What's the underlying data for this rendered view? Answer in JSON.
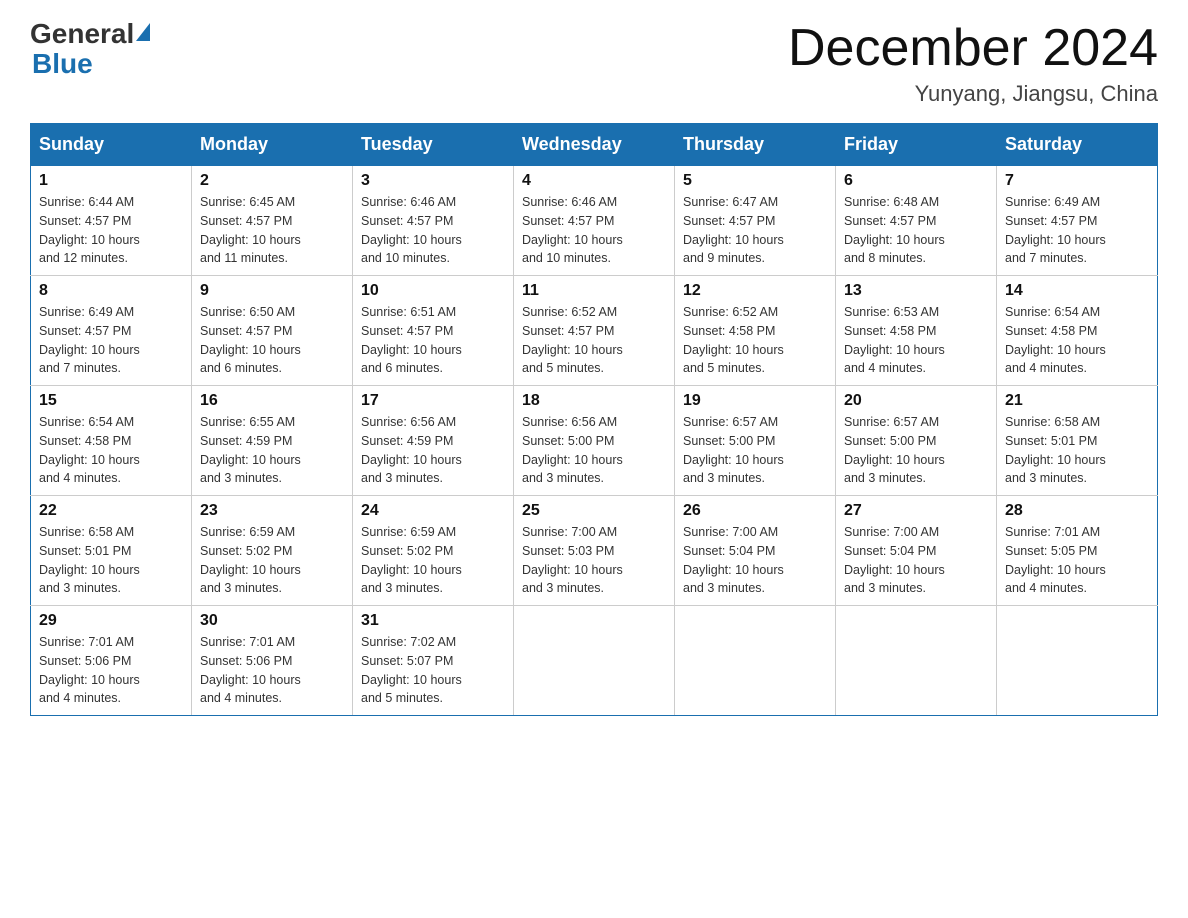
{
  "header": {
    "logo_general": "General",
    "logo_blue": "Blue",
    "title": "December 2024",
    "subtitle": "Yunyang, Jiangsu, China"
  },
  "columns": [
    "Sunday",
    "Monday",
    "Tuesday",
    "Wednesday",
    "Thursday",
    "Friday",
    "Saturday"
  ],
  "weeks": [
    [
      {
        "num": "1",
        "info": "Sunrise: 6:44 AM\nSunset: 4:57 PM\nDaylight: 10 hours\nand 12 minutes."
      },
      {
        "num": "2",
        "info": "Sunrise: 6:45 AM\nSunset: 4:57 PM\nDaylight: 10 hours\nand 11 minutes."
      },
      {
        "num": "3",
        "info": "Sunrise: 6:46 AM\nSunset: 4:57 PM\nDaylight: 10 hours\nand 10 minutes."
      },
      {
        "num": "4",
        "info": "Sunrise: 6:46 AM\nSunset: 4:57 PM\nDaylight: 10 hours\nand 10 minutes."
      },
      {
        "num": "5",
        "info": "Sunrise: 6:47 AM\nSunset: 4:57 PM\nDaylight: 10 hours\nand 9 minutes."
      },
      {
        "num": "6",
        "info": "Sunrise: 6:48 AM\nSunset: 4:57 PM\nDaylight: 10 hours\nand 8 minutes."
      },
      {
        "num": "7",
        "info": "Sunrise: 6:49 AM\nSunset: 4:57 PM\nDaylight: 10 hours\nand 7 minutes."
      }
    ],
    [
      {
        "num": "8",
        "info": "Sunrise: 6:49 AM\nSunset: 4:57 PM\nDaylight: 10 hours\nand 7 minutes."
      },
      {
        "num": "9",
        "info": "Sunrise: 6:50 AM\nSunset: 4:57 PM\nDaylight: 10 hours\nand 6 minutes."
      },
      {
        "num": "10",
        "info": "Sunrise: 6:51 AM\nSunset: 4:57 PM\nDaylight: 10 hours\nand 6 minutes."
      },
      {
        "num": "11",
        "info": "Sunrise: 6:52 AM\nSunset: 4:57 PM\nDaylight: 10 hours\nand 5 minutes."
      },
      {
        "num": "12",
        "info": "Sunrise: 6:52 AM\nSunset: 4:58 PM\nDaylight: 10 hours\nand 5 minutes."
      },
      {
        "num": "13",
        "info": "Sunrise: 6:53 AM\nSunset: 4:58 PM\nDaylight: 10 hours\nand 4 minutes."
      },
      {
        "num": "14",
        "info": "Sunrise: 6:54 AM\nSunset: 4:58 PM\nDaylight: 10 hours\nand 4 minutes."
      }
    ],
    [
      {
        "num": "15",
        "info": "Sunrise: 6:54 AM\nSunset: 4:58 PM\nDaylight: 10 hours\nand 4 minutes."
      },
      {
        "num": "16",
        "info": "Sunrise: 6:55 AM\nSunset: 4:59 PM\nDaylight: 10 hours\nand 3 minutes."
      },
      {
        "num": "17",
        "info": "Sunrise: 6:56 AM\nSunset: 4:59 PM\nDaylight: 10 hours\nand 3 minutes."
      },
      {
        "num": "18",
        "info": "Sunrise: 6:56 AM\nSunset: 5:00 PM\nDaylight: 10 hours\nand 3 minutes."
      },
      {
        "num": "19",
        "info": "Sunrise: 6:57 AM\nSunset: 5:00 PM\nDaylight: 10 hours\nand 3 minutes."
      },
      {
        "num": "20",
        "info": "Sunrise: 6:57 AM\nSunset: 5:00 PM\nDaylight: 10 hours\nand 3 minutes."
      },
      {
        "num": "21",
        "info": "Sunrise: 6:58 AM\nSunset: 5:01 PM\nDaylight: 10 hours\nand 3 minutes."
      }
    ],
    [
      {
        "num": "22",
        "info": "Sunrise: 6:58 AM\nSunset: 5:01 PM\nDaylight: 10 hours\nand 3 minutes."
      },
      {
        "num": "23",
        "info": "Sunrise: 6:59 AM\nSunset: 5:02 PM\nDaylight: 10 hours\nand 3 minutes."
      },
      {
        "num": "24",
        "info": "Sunrise: 6:59 AM\nSunset: 5:02 PM\nDaylight: 10 hours\nand 3 minutes."
      },
      {
        "num": "25",
        "info": "Sunrise: 7:00 AM\nSunset: 5:03 PM\nDaylight: 10 hours\nand 3 minutes."
      },
      {
        "num": "26",
        "info": "Sunrise: 7:00 AM\nSunset: 5:04 PM\nDaylight: 10 hours\nand 3 minutes."
      },
      {
        "num": "27",
        "info": "Sunrise: 7:00 AM\nSunset: 5:04 PM\nDaylight: 10 hours\nand 3 minutes."
      },
      {
        "num": "28",
        "info": "Sunrise: 7:01 AM\nSunset: 5:05 PM\nDaylight: 10 hours\nand 4 minutes."
      }
    ],
    [
      {
        "num": "29",
        "info": "Sunrise: 7:01 AM\nSunset: 5:06 PM\nDaylight: 10 hours\nand 4 minutes."
      },
      {
        "num": "30",
        "info": "Sunrise: 7:01 AM\nSunset: 5:06 PM\nDaylight: 10 hours\nand 4 minutes."
      },
      {
        "num": "31",
        "info": "Sunrise: 7:02 AM\nSunset: 5:07 PM\nDaylight: 10 hours\nand 5 minutes."
      },
      null,
      null,
      null,
      null
    ]
  ]
}
